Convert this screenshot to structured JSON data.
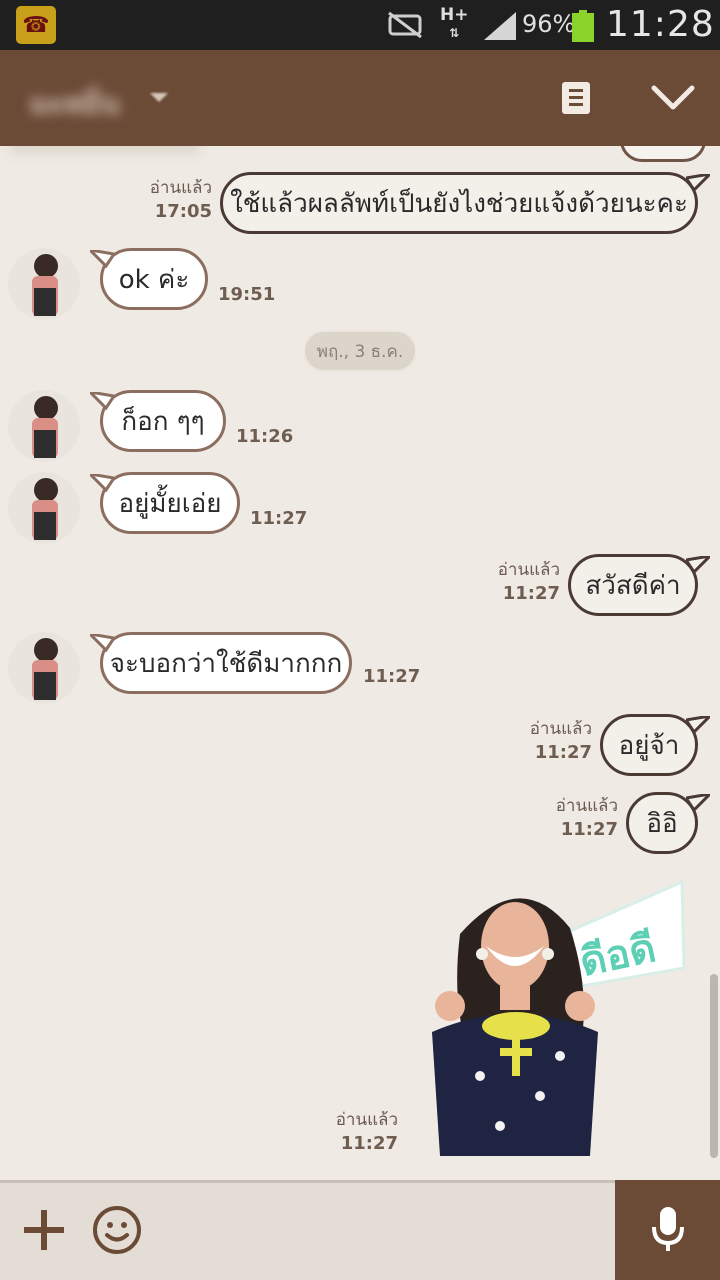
{
  "status_bar": {
    "network": "H+",
    "battery_percent": "96%",
    "time": "11:28",
    "icons": [
      "call-app-icon",
      "mute-icon",
      "signal-icon",
      "battery-icon"
    ]
  },
  "header": {
    "title": "มะหมิ่น",
    "icons": [
      "dropdown-caret-icon",
      "notes-icon",
      "chevron-down-icon"
    ]
  },
  "messages": {
    "m1": {
      "text": "ใช้แล้วผลลัพท์เป็นยังไงช่วยแจ้งด้วยนะคะ",
      "read": "อ่านแล้ว",
      "time": "17:05"
    },
    "m2": {
      "text": "ok ค่ะ",
      "time": "19:51"
    },
    "date": "พฤ., 3 ธ.ค.",
    "m3": {
      "text": "ก็อก ๆๆ",
      "time": "11:26"
    },
    "m4": {
      "text": "อยู่มั้ยเอ่ย",
      "time": "11:27"
    },
    "m5": {
      "text": "สวัสดีค่า",
      "read": "อ่านแล้ว",
      "time": "11:27"
    },
    "m6": {
      "text": "จะบอกว่าใช้ดีมากกก",
      "time": "11:27"
    },
    "m7": {
      "text": "อยู่จ้า",
      "read": "อ่านแล้ว",
      "time": "11:27"
    },
    "m8": {
      "text": "อิอิ",
      "read": "อ่านแล้ว",
      "time": "11:27"
    },
    "sticker": {
      "caption": "ดีอดี",
      "read": "อ่านแล้ว",
      "time": "11:27"
    }
  },
  "input_bar": {
    "icons": [
      "plus-icon",
      "emoji-icon",
      "microphone-icon"
    ]
  },
  "colors": {
    "header": "#6b4a36",
    "background": "#efebe4",
    "bubble_border": "#8b6e5f",
    "sticker_text": "#5dcfb4"
  }
}
